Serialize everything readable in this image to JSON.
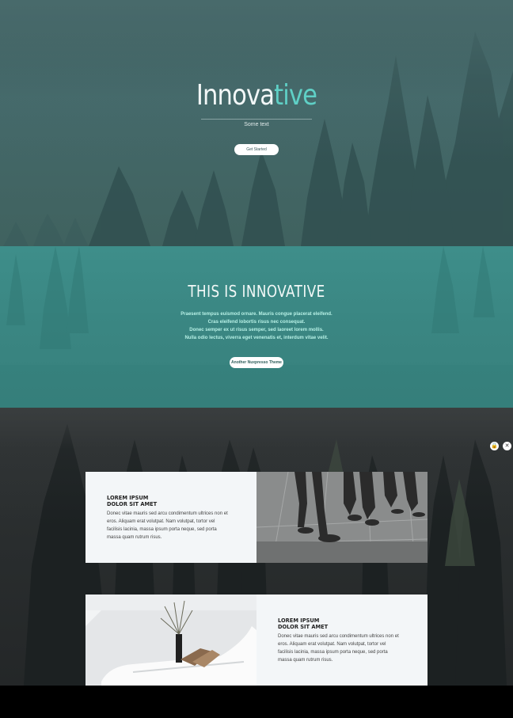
{
  "hero": {
    "title_main": "Innova",
    "title_accent": "tive",
    "subtitle": "Some text",
    "cta_label": "Get Started"
  },
  "band": {
    "title": "THIS IS INNOVATIVE",
    "lines": [
      "Praesent tempus euismod ornare. Mauris congue placerat eleifend.",
      "Cras eleifend lobortis risus nec consequat.",
      "Donec semper ex ut risus semper, sed laoreet lorem mollis.",
      "Nulla odio lectus, viverra eget venenatis et, interdum vitae velit."
    ],
    "cta_label": "Another Nuxpresso Theme"
  },
  "floating": {
    "left_icon": "lock-icon",
    "right_icon": "close-icon",
    "left_glyph": "🔒",
    "right_glyph": "✕"
  },
  "cards": [
    {
      "heading_line1": "LOREM IPSUM",
      "heading_line2": "DOLOR SIT AMET",
      "body_lines": [
        "Donec vitae mauris sed arcu condimentum ultrices non et",
        "eros. Aliquam erat volutpat. Nam volutpat, tortor vel",
        "facilisis lacinia, massa ipsum porta neque, sed porta",
        "massa quam rutrum risus."
      ],
      "image": "walking-people-photo"
    },
    {
      "heading_line1": "LOREM IPSUM",
      "heading_line2": "DOLOR SIT AMET",
      "body_lines": [
        "Donec vitae mauris sed arcu condimentum ultrices non et",
        "eros. Aliquam erat volutpat. Nam volutpat, tortor vel",
        "facilisis lacinia, massa ipsum porta neque, sed porta",
        "massa quam rutrum risus."
      ],
      "image": "white-chair-vase-photo"
    }
  ]
}
